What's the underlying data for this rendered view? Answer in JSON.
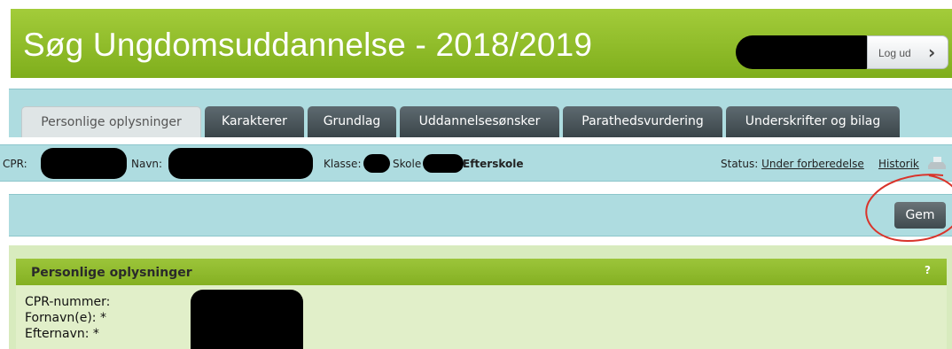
{
  "header": {
    "title": "Søg Ungdomsuddannelse - 2018/2019",
    "logout_label": "Log ud",
    "logout_icon": "chevron-right-icon"
  },
  "tabs": [
    {
      "label": "Personlige oplysninger",
      "active": true
    },
    {
      "label": "Karakterer",
      "active": false
    },
    {
      "label": "Grundlag",
      "active": false
    },
    {
      "label": "Uddannelsesønsker",
      "active": false
    },
    {
      "label": "Parathedsvurdering",
      "active": false
    },
    {
      "label": "Underskrifter og bilag",
      "active": false
    }
  ],
  "infobar": {
    "cpr_label": "CPR:",
    "navn_label": "Navn:",
    "klasse_label": "Klasse:",
    "skole_label": "Skole",
    "school_type": "Efterskole",
    "status_label": "Status:",
    "status_value": "Under forberedelse",
    "history_link": "Historik",
    "print_icon": "print-icon"
  },
  "toolbar": {
    "save_label": "Gem"
  },
  "section": {
    "title": "Personlige oplysninger",
    "help": "?",
    "fields": [
      "CPR-nummer:",
      "Fornavn(e): *",
      "Efternavn: *"
    ]
  },
  "colors": {
    "header_green": "#8fbc2a",
    "panel_teal": "#aedce0",
    "tab_dark": "#4a555a",
    "section_green": "#d8ebbe",
    "annotation_red": "#d9342b"
  }
}
